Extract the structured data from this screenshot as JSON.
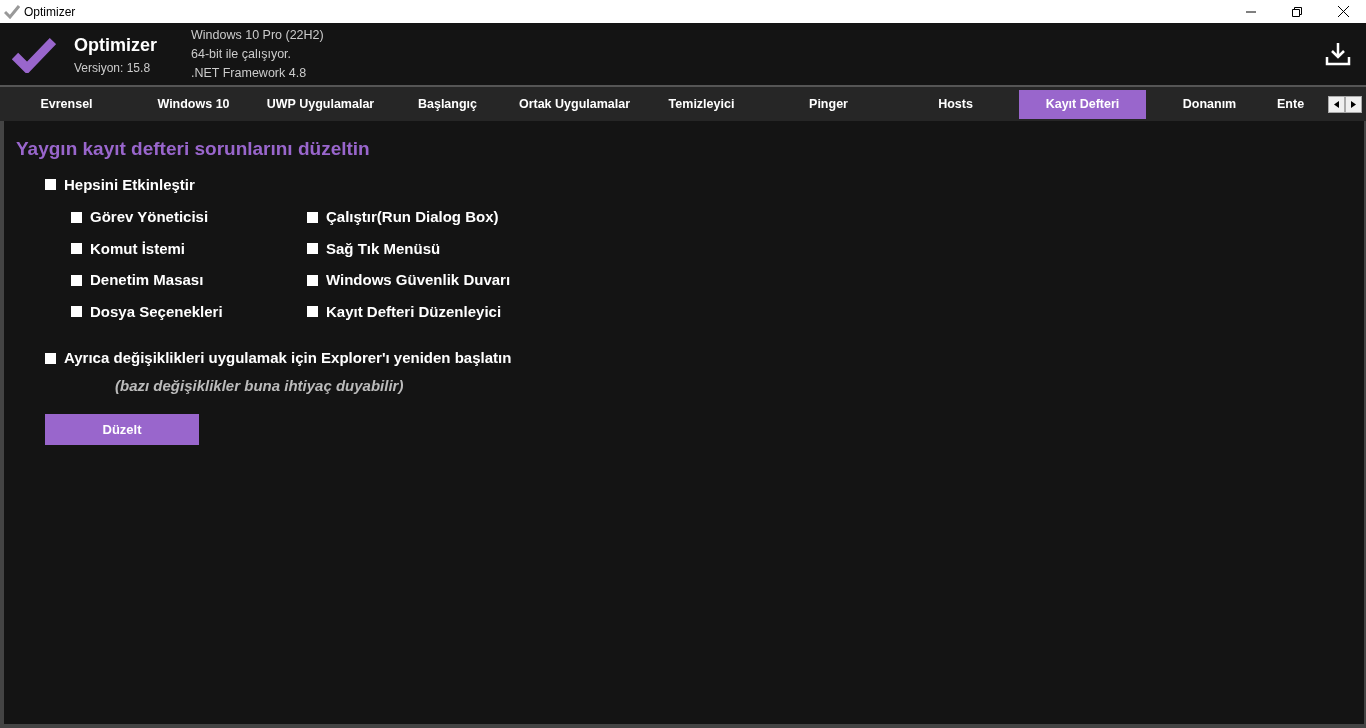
{
  "window": {
    "title": "Optimizer"
  },
  "header": {
    "app_name": "Optimizer",
    "version": "Versiyon: 15.8",
    "info": [
      "Windows 10 Pro (22H2)",
      "64-bit ile çalışıyor.",
      ".NET Framework 4.8"
    ]
  },
  "tabs": [
    {
      "label": "Evrensel",
      "selected": false
    },
    {
      "label": "Windows 10",
      "selected": false
    },
    {
      "label": "UWP Uygulamalar",
      "selected": false
    },
    {
      "label": "Başlangıç",
      "selected": false
    },
    {
      "label": "Ortak Uygulamalar",
      "selected": false
    },
    {
      "label": "Temizleyici",
      "selected": false
    },
    {
      "label": "Pinger",
      "selected": false
    },
    {
      "label": "Hosts",
      "selected": false
    },
    {
      "label": "Kayıt Defteri",
      "selected": true
    },
    {
      "label": "Donanım",
      "selected": false
    },
    {
      "label": "Ente",
      "selected": false
    }
  ],
  "content": {
    "heading": "Yaygın kayıt defteri sorunlarını düzeltin",
    "enable_all": {
      "label": "Hepsini Etkinleştir",
      "checked": false
    },
    "options": [
      {
        "label": "Görev Yöneticisi",
        "checked": false
      },
      {
        "label": "Çalıştır(Run Dialog Box)",
        "checked": false
      },
      {
        "label": "Komut İstemi",
        "checked": false
      },
      {
        "label": "Sağ Tık Menüsü",
        "checked": false
      },
      {
        "label": "Denetim Masası",
        "checked": false
      },
      {
        "label": "Windows Güvenlik Duvarı",
        "checked": false
      },
      {
        "label": "Dosya Seçenekleri",
        "checked": false
      },
      {
        "label": "Kayıt Defteri Düzenleyici",
        "checked": false
      }
    ],
    "restart_explorer": {
      "label": "Ayrıca değişiklikleri uygulamak için Explorer'ı yeniden başlatın",
      "checked": false
    },
    "note": "(bazı değişiklikler buna ihtiyaç duyabilir)",
    "button": "Düzelt"
  }
}
